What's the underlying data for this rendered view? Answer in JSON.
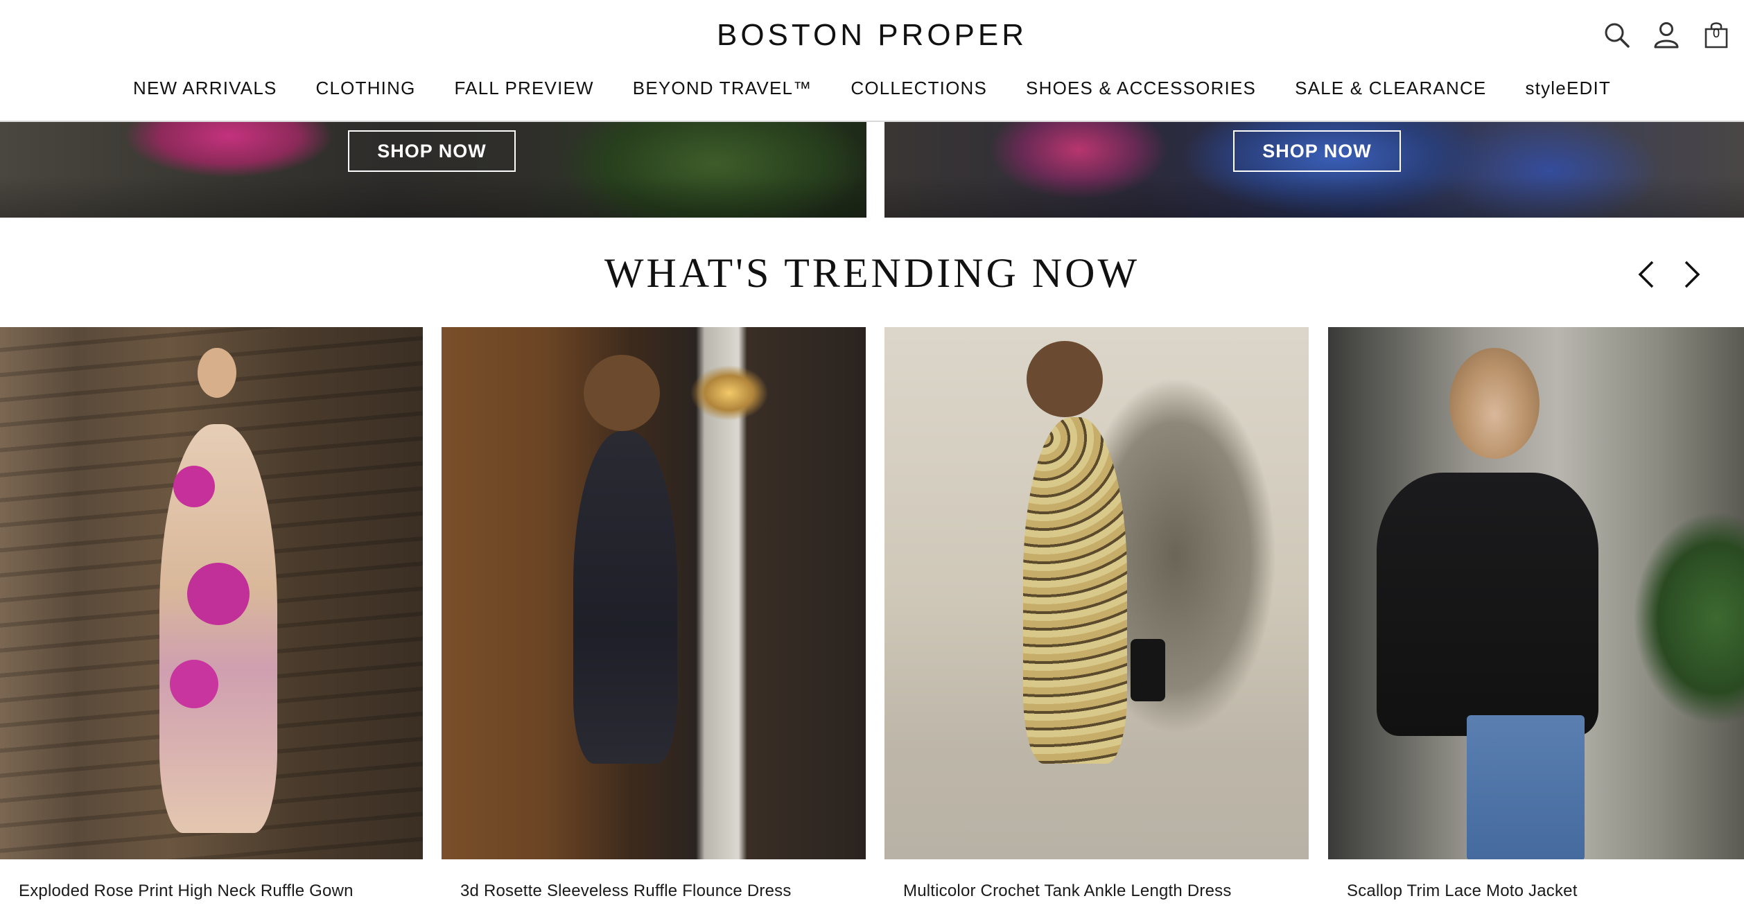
{
  "header": {
    "logo": "BOSTON PROPER",
    "bag_count": "0",
    "icons": [
      "search-icon",
      "account-icon",
      "bag-icon"
    ]
  },
  "nav": {
    "items": [
      "NEW ARRIVALS",
      "CLOTHING",
      "FALL PREVIEW",
      "BEYOND TRAVEL™",
      "COLLECTIONS",
      "SHOES & ACCESSORIES",
      "SALE & CLEARANCE",
      "styleEDIT"
    ]
  },
  "hero": {
    "left_button": "SHOP NOW",
    "right_button": "SHOP NOW"
  },
  "trending": {
    "title": "WHAT'S TRENDING NOW",
    "products": [
      {
        "name": "Exploded Rose Print High Neck Ruffle Gown"
      },
      {
        "name": "3d Rosette Sleeveless Ruffle Flounce Dress"
      },
      {
        "name": "Multicolor Crochet Tank Ankle Length Dress"
      },
      {
        "name": "Scallop Trim Lace Moto Jacket"
      }
    ]
  },
  "colors": {
    "text": "#111111",
    "border": "#d9d9d9",
    "button_text": "#ffffff"
  }
}
